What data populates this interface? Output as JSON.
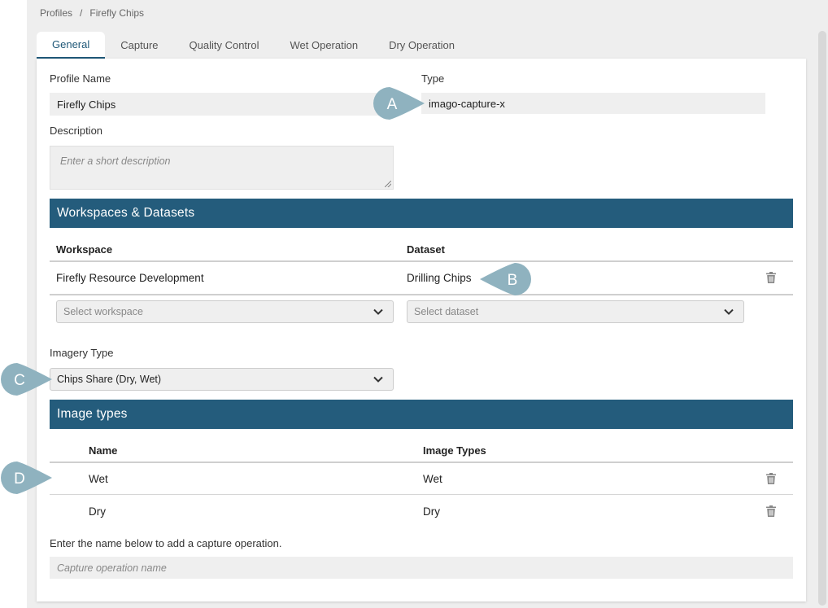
{
  "breadcrumb": {
    "root": "Profiles",
    "separator": "/",
    "current": "Firefly Chips"
  },
  "tabs": [
    {
      "label": "General",
      "active": true
    },
    {
      "label": "Capture",
      "active": false
    },
    {
      "label": "Quality Control",
      "active": false
    },
    {
      "label": "Wet Operation",
      "active": false
    },
    {
      "label": "Dry Operation",
      "active": false
    }
  ],
  "general": {
    "profile_name_label": "Profile Name",
    "profile_name_value": "Firefly Chips",
    "type_label": "Type",
    "type_value": "imago-capture-x",
    "description_label": "Description",
    "description_placeholder": "Enter a short description"
  },
  "workspaces": {
    "title": "Workspaces & Datasets",
    "col_workspace": "Workspace",
    "col_dataset": "Dataset",
    "rows": [
      {
        "workspace": "Firefly Resource Development",
        "dataset": "Drilling Chips"
      }
    ],
    "select_workspace_placeholder": "Select workspace",
    "select_dataset_placeholder": "Select dataset"
  },
  "imagery": {
    "label": "Imagery Type",
    "selected": "Chips Share (Dry, Wet)"
  },
  "image_types": {
    "title": "Image types",
    "col_name": "Name",
    "col_types": "Image Types",
    "rows": [
      {
        "name": "Wet",
        "types": "Wet"
      },
      {
        "name": "Dry",
        "types": "Dry"
      }
    ],
    "hint": "Enter the name below to add a capture operation.",
    "input_placeholder": "Capture operation name"
  },
  "callouts": {
    "a": "A",
    "b": "B",
    "c": "C",
    "d": "D"
  },
  "colors": {
    "accent": "#245c7c",
    "callout": "#8fb2bf",
    "page_bg": "#eeeeee"
  }
}
